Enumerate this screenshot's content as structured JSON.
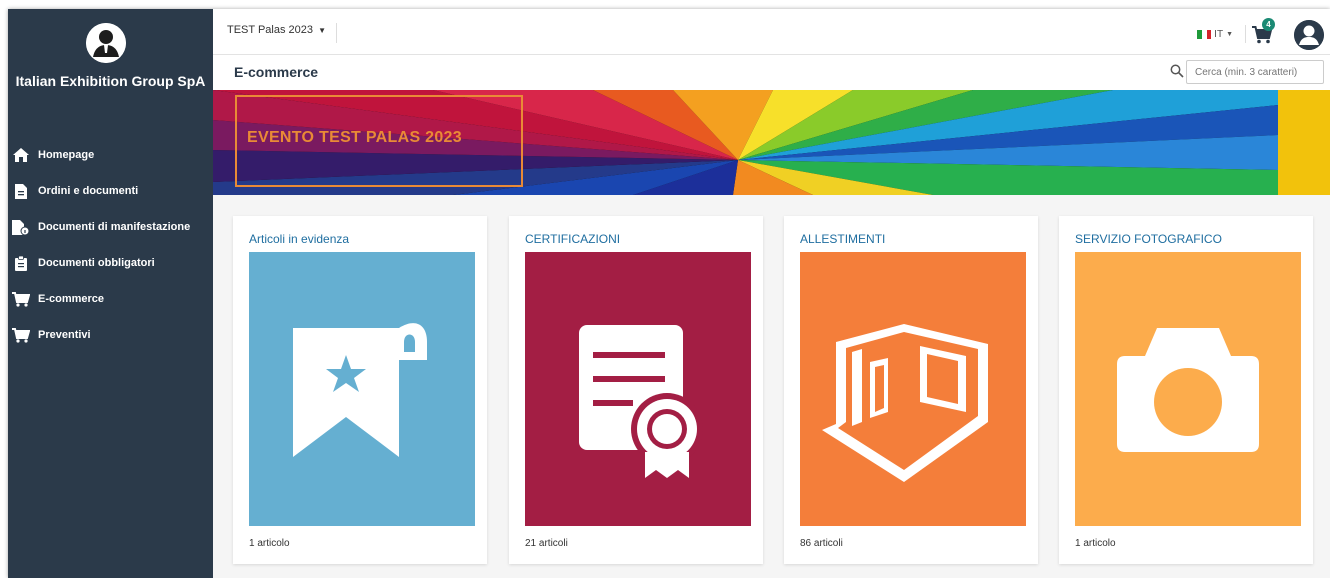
{
  "org_name": "Italian Exhibition Group SpA",
  "sidebar": {
    "items": [
      {
        "label": "Homepage",
        "icon": "home-icon"
      },
      {
        "label": "Ordini e documenti",
        "icon": "document-icon"
      },
      {
        "label": "Documenti di manifestazione",
        "icon": "document-info-icon"
      },
      {
        "label": "Documenti obbligatori",
        "icon": "clipboard-icon"
      },
      {
        "label": "E-commerce",
        "icon": "cart-icon"
      },
      {
        "label": "Preventivi",
        "icon": "cart-icon"
      }
    ]
  },
  "topbar": {
    "event_select": "TEST Palas 2023",
    "language": "IT",
    "cart_count": "4"
  },
  "page": {
    "title": "E-commerce",
    "search_placeholder": "Cerca (min. 3 caratteri)"
  },
  "banner": {
    "title": "EVENTO TEST PALAS 2023"
  },
  "categories": [
    {
      "title": "Articoli in evidenza",
      "count": "1 articolo",
      "color": "#65afd1",
      "icon": "bookmark-star-icon"
    },
    {
      "title": "CERTIFICAZIONI",
      "count": "21 articoli",
      "color": "#a31e44",
      "icon": "certificate-icon"
    },
    {
      "title": "ALLESTIMENTI",
      "count": "86 articoli",
      "color": "#f47e3a",
      "icon": "stand-icon"
    },
    {
      "title": "SERVIZIO FOTOGRAFICO",
      "count": "1 articolo",
      "color": "#fcac4c",
      "icon": "camera-icon"
    }
  ],
  "colors": {
    "sidebar": "#2b3a4a",
    "accent_text": "#1f6ea0",
    "banner_title": "#e98a36",
    "badge": "#1b8a74"
  }
}
